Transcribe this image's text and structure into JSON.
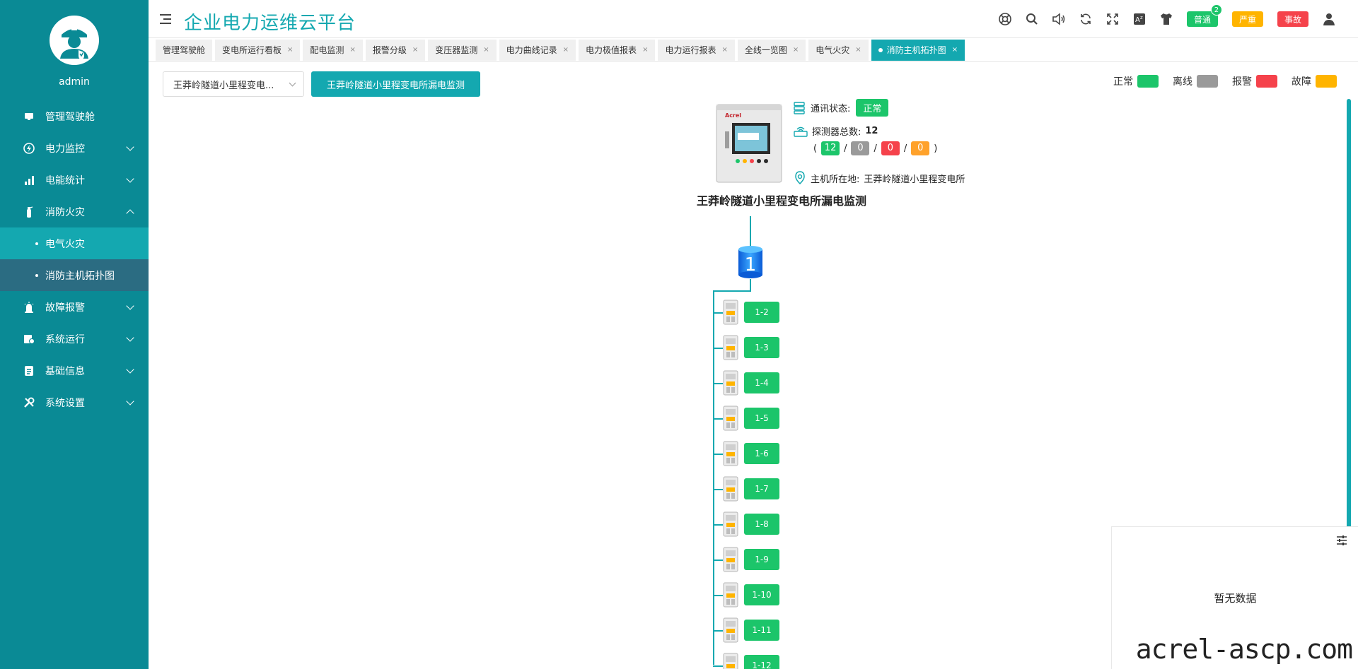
{
  "user": {
    "name": "admin"
  },
  "sidebar": {
    "items": [
      {
        "label": "管理驾驶舱",
        "icon": "monitor-icon"
      },
      {
        "label": "电力监控",
        "icon": "power-icon"
      },
      {
        "label": "电能统计",
        "icon": "bar-chart-icon"
      },
      {
        "label": "消防火灾",
        "icon": "extinguisher-icon"
      },
      {
        "label": "故障报警",
        "icon": "alarm-icon"
      },
      {
        "label": "系统运行",
        "icon": "server-icon"
      },
      {
        "label": "基础信息",
        "icon": "document-icon"
      },
      {
        "label": "系统设置",
        "icon": "tools-icon"
      }
    ],
    "sub_items": [
      {
        "label": "电气火灾"
      },
      {
        "label": "消防主机拓扑图"
      }
    ]
  },
  "header": {
    "title": "企业电力运维云平台",
    "badges": {
      "normal": "普通",
      "normal_count": "2",
      "serious": "严重",
      "accident": "事故"
    },
    "colors": {
      "normal": "#1cc56a",
      "serious": "#ffb400",
      "accident": "#f5424b"
    }
  },
  "tabs": [
    {
      "label": "管理驾驶舱",
      "closable": false
    },
    {
      "label": "变电所运行看板",
      "closable": true
    },
    {
      "label": "配电监测",
      "closable": true
    },
    {
      "label": "报警分级",
      "closable": true
    },
    {
      "label": "变压器监测",
      "closable": true
    },
    {
      "label": "电力曲线记录",
      "closable": true
    },
    {
      "label": "电力极值报表",
      "closable": true
    },
    {
      "label": "电力运行报表",
      "closable": true
    },
    {
      "label": "全线一览图",
      "closable": true
    },
    {
      "label": "电气火灾",
      "closable": true
    },
    {
      "label": "消防主机拓扑图",
      "closable": true,
      "active": true
    }
  ],
  "toolbar": {
    "select_value": "王莽岭隧道小里程变电...",
    "button_label": "王莽岭隧道小里程变电所漏电监测"
  },
  "legend": [
    {
      "label": "正常",
      "color": "#1cc56a"
    },
    {
      "label": "离线",
      "color": "#9a9a9a"
    },
    {
      "label": "报警",
      "color": "#f5424b"
    },
    {
      "label": "故障",
      "color": "#ffb400"
    }
  ],
  "host": {
    "brand": "Acrel",
    "name": "王莽岭隧道小里程变电所漏电监测",
    "comm_label": "通讯状态:",
    "comm_status": "正常",
    "detector_label": "探测器总数:",
    "detector_total": "12",
    "counts": {
      "normal": "12",
      "offline": "0",
      "alarm": "0",
      "fault": "0"
    },
    "location_label": "主机所在地:",
    "location": "王莽岭隧道小里程变电所"
  },
  "tree": {
    "bus_label": "1",
    "nodes": [
      "1-2",
      "1-3",
      "1-4",
      "1-5",
      "1-6",
      "1-7",
      "1-8",
      "1-9",
      "1-10",
      "1-11",
      "1-12"
    ]
  },
  "panel": {
    "empty_text": "暂无数据"
  },
  "watermark": "acrel-ascp.com"
}
